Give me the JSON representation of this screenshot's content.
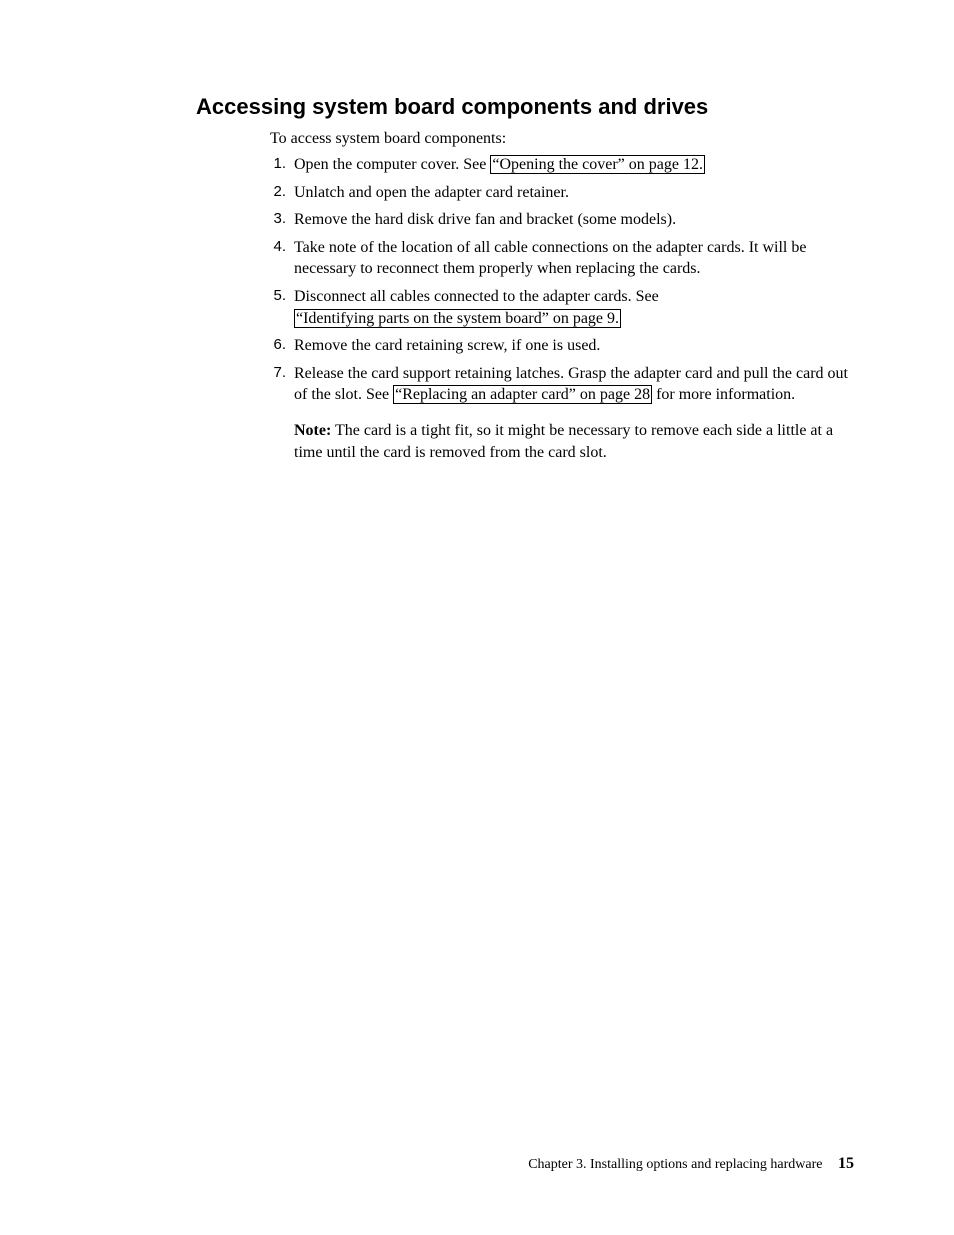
{
  "heading": "Accessing system board components and drives",
  "intro": "To access system board components:",
  "items": [
    {
      "marker": "1.",
      "pre": "Open the computer cover. See ",
      "link": "“Opening the cover” on page 12.",
      "post": ""
    },
    {
      "marker": "2.",
      "pre": "Unlatch and open the adapter card retainer.",
      "link": "",
      "post": ""
    },
    {
      "marker": "3.",
      "pre": "Remove the hard disk drive fan and bracket (some models).",
      "link": "",
      "post": ""
    },
    {
      "marker": "4.",
      "pre": "Take note of the location of all cable connections on the adapter cards. It will be necessary to reconnect them properly when replacing the cards.",
      "link": "",
      "post": ""
    },
    {
      "marker": "5.",
      "pre": "Disconnect all cables connected to the adapter cards. See ",
      "link": "“Identifying parts on the system board” on page 9.",
      "post": ""
    },
    {
      "marker": "6.",
      "pre": "Remove the card retaining screw, if one is used.",
      "link": "",
      "post": ""
    },
    {
      "marker": "7.",
      "pre": "Release the card support retaining latches. Grasp the adapter card and pull the card out of the slot. See ",
      "link": "“Replacing an adapter card” on page 28",
      "post": " for more information.",
      "noteLabel": "Note:",
      "noteText": " The card is a tight fit, so it might be necessary to remove each side a little at a time until the card is removed from the card slot."
    }
  ],
  "footer": {
    "chapter": "Chapter 3. Installing options and replacing hardware",
    "page": "15"
  }
}
